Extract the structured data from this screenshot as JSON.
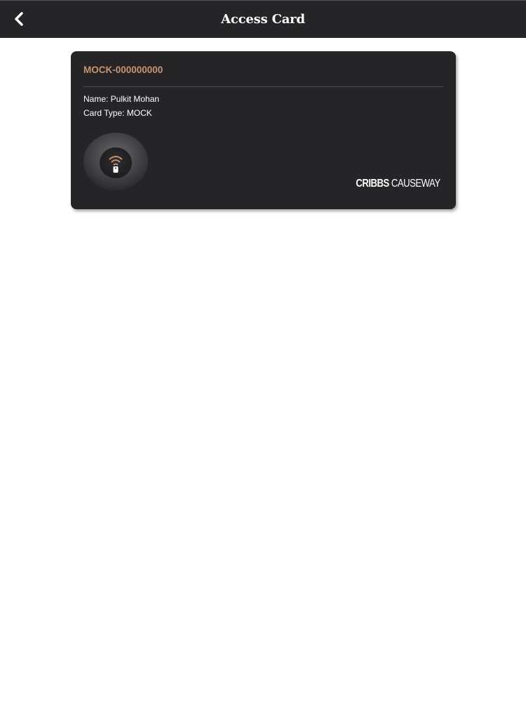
{
  "header": {
    "title": "Access Card",
    "back_icon": "chevron-left-icon"
  },
  "card": {
    "number": "MOCK-000000000",
    "name_line": "Name: Pulkit Mohan",
    "type_line": "Card Type: MOCK",
    "nfc_icon": "nfc-tap-icon",
    "brand": {
      "bold": "CRIBBS",
      "light": " CAUSEWAY"
    }
  },
  "colors": {
    "header_bg": "#252427",
    "card_bg": "#252427",
    "accent": "#c89470",
    "page_bg": "#ffffff"
  }
}
